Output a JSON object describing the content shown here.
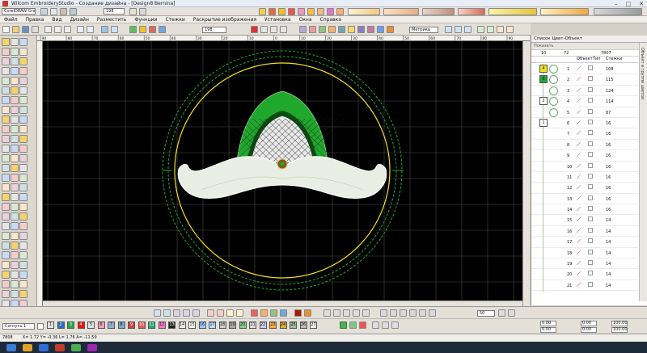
{
  "window": {
    "title": "Wilcom EmbroideryStudio - Создание дизайна - [Design8     Bernina]",
    "buttons": [
      "–",
      "□",
      "✕"
    ]
  },
  "toolbar_top": {
    "graphics_combo": "CorelDRAW Graphics",
    "number_combo": "198"
  },
  "menu": [
    "Файл",
    "Правка",
    "Вид",
    "Дизайн",
    "Разместить",
    "Функции",
    "Стежки",
    "Раскрытие изображения",
    "Установка",
    "Окна",
    "Справка"
  ],
  "toolbar2": {
    "size_combo": "198",
    "units_combo": "Метрика"
  },
  "ruler_h_labels": [
    "90",
    "80",
    "70",
    "60",
    "50",
    "40",
    "30",
    "20",
    "10",
    "0",
    "10",
    "20",
    "30",
    "40",
    "50",
    "60",
    "70",
    "80",
    "90"
  ],
  "right_panel": {
    "title": "Список Цвет-Объект",
    "show_btn": "Показать",
    "header": {
      "count": "10",
      "c2": "72",
      "stitches": "7807"
    },
    "col_labels": [
      "Объект",
      "Тип",
      "Стежки"
    ],
    "vertical_tab": "Объект в группе цветов",
    "rows": [
      {
        "n": "1",
        "s": "108",
        "sw": "#f2e51a",
        "grp": "4"
      },
      {
        "n": "2",
        "s": "115",
        "sw": "#23a33a",
        "grp": "3"
      },
      {
        "n": "3",
        "s": "124",
        "sw": "",
        "grp": ""
      },
      {
        "n": "4",
        "s": "114",
        "sw": "#ffffff",
        "grp": "2"
      },
      {
        "n": "5",
        "s": "87",
        "sw": "",
        "grp": ""
      },
      {
        "n": "6",
        "s": "16",
        "sw": "#ffffff",
        "grp": "1"
      },
      {
        "n": "7",
        "s": "16"
      },
      {
        "n": "8",
        "s": "16"
      },
      {
        "n": "9",
        "s": "16"
      },
      {
        "n": "10",
        "s": "16"
      },
      {
        "n": "11",
        "s": "16"
      },
      {
        "n": "12",
        "s": "16"
      },
      {
        "n": "13",
        "s": "16"
      },
      {
        "n": "14",
        "s": "16"
      },
      {
        "n": "15",
        "s": "14"
      },
      {
        "n": "16",
        "s": "14"
      },
      {
        "n": "17",
        "s": "14"
      },
      {
        "n": "18",
        "s": "14"
      },
      {
        "n": "19",
        "s": "14"
      },
      {
        "n": "20",
        "s": "14"
      },
      {
        "n": "21",
        "s": "14"
      }
    ]
  },
  "bottom": {
    "style_combo": "Согнуть 1",
    "value_combo": "1.00",
    "zoom_combo": "50",
    "palette_numbers": [
      "1",
      "2",
      "3",
      "4",
      "5",
      "6",
      "7",
      "8",
      "9",
      "10",
      "11",
      "12",
      "13",
      "14",
      "15",
      "16",
      "17",
      "18",
      "19",
      "20",
      "21",
      "22",
      "23",
      "24",
      "25",
      "26",
      "27"
    ],
    "palette_colors": [
      "#e6e6e6",
      "#2c6fbb",
      "#22aa44",
      "#e11",
      "#e4e4e4",
      "#f2a2c0",
      "#9ad",
      "#7ac",
      "#c44",
      "#e55",
      "#2a7",
      "#f7c",
      "#222",
      "#eee",
      "#fff",
      "#9cf",
      "#bdf",
      "#ccc",
      "#aaa",
      "#8c8",
      "#ddd",
      "#cce",
      "#fa4",
      "#da3",
      "#9b9",
      "#bbb",
      "#eee"
    ],
    "right_fields": [
      "0.00",
      "0.00",
      "100.00",
      "100.00"
    ]
  },
  "status": {
    "stitches": "7808",
    "coords": "X= 1.72 Y= -0.36 L= 1.76 A= -11.59"
  },
  "colors": {
    "canvas": "#000000",
    "green": "#1fa82c",
    "yellow": "#f2e51a",
    "white_fill": "#e9eee4"
  }
}
